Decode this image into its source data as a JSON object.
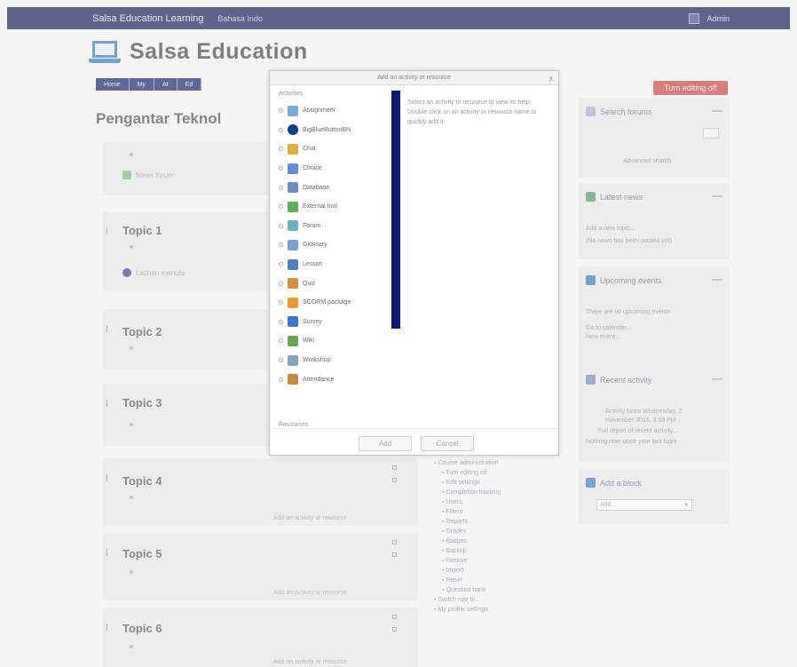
{
  "navbar": {
    "brand": "Salsa Education Learning",
    "language": "Bahasa Indo",
    "user_name": "Admin"
  },
  "header": {
    "site_title": "Salsa Education"
  },
  "nav_buttons": [
    "Home",
    "My",
    "At",
    "Ed"
  ],
  "course": {
    "title": "Pengantar Teknol"
  },
  "sections": [
    {
      "title": "",
      "activity": "News forum"
    },
    {
      "title": "Topic 1",
      "activity": "Latihan menulis"
    },
    {
      "title": "Topic 2"
    },
    {
      "title": "Topic 3"
    },
    {
      "title": "Topic 4",
      "hint": "Add an activity or resource"
    },
    {
      "title": "Topic 5",
      "hint": "Add an activity or resource"
    },
    {
      "title": "Topic 6",
      "hint": "Add an activity or resource"
    }
  ],
  "right_blocks": {
    "edit_button": "Turn editing off",
    "search_forums": {
      "title": "Search forums",
      "note": "Advanced search"
    },
    "latest_news": {
      "title": "Latest news",
      "line1": "Add a new topic...",
      "line2": "(No news has been posted yet)"
    },
    "upcoming_events": {
      "title": "Upcoming events",
      "line1": "There are no upcoming events",
      "line2": "Go to calendar...",
      "line3": "New event..."
    },
    "recent_activity": {
      "title": "Recent activity",
      "line1": "Activity since Wednesday, 2",
      "line2": "November 2016, 3:58 PM",
      "line3": "Full report of recent activity...",
      "line4": "Nothing new since your last login"
    },
    "add_block": {
      "title": "Add a block",
      "select_value": "Add..."
    }
  },
  "admin_tree": [
    {
      "label": "Course administration",
      "level": 1
    },
    {
      "label": "Turn editing off",
      "level": 2
    },
    {
      "label": "Edit settings",
      "level": 2
    },
    {
      "label": "Completion tracking",
      "level": 2
    },
    {
      "label": "Users",
      "level": 2
    },
    {
      "label": "Filters",
      "level": 2
    },
    {
      "label": "Reports",
      "level": 2
    },
    {
      "label": "Grades",
      "level": 2
    },
    {
      "label": "Badges",
      "level": 2
    },
    {
      "label": "Backup",
      "level": 2
    },
    {
      "label": "Restore",
      "level": 2
    },
    {
      "label": "Import",
      "level": 2
    },
    {
      "label": "Reset",
      "level": 2
    },
    {
      "label": "Question bank",
      "level": 2
    },
    {
      "label": "Switch role to...",
      "level": 1
    },
    {
      "label": "My profile settings",
      "level": 1
    }
  ],
  "modal": {
    "title": "Add an activity or resource",
    "close_label": "x",
    "options_heading": "Activities",
    "options": [
      {
        "label": "Assignment",
        "color": "#7fa8d6"
      },
      {
        "label": "BigBlueButtonBN",
        "color": "#1a3c8c"
      },
      {
        "label": "Chat",
        "color": "#e0b23a"
      },
      {
        "label": "Choice",
        "color": "#5a8fd6"
      },
      {
        "label": "Database",
        "color": "#6a8ec4"
      },
      {
        "label": "External tool",
        "color": "#5bb05b"
      },
      {
        "label": "Forum",
        "color": "#6bb2c2"
      },
      {
        "label": "Glossary",
        "color": "#7da2c8"
      },
      {
        "label": "Lesson",
        "color": "#4f7fc4"
      },
      {
        "label": "Quiz",
        "color": "#d98f3a"
      },
      {
        "label": "SCORM package",
        "color": "#e69d2e"
      },
      {
        "label": "Survey",
        "color": "#3a78c8"
      },
      {
        "label": "Wiki",
        "color": "#6aa84f"
      },
      {
        "label": "Workshop",
        "color": "#8aa0c0"
      },
      {
        "label": "Attendance",
        "color": "#c58a3a"
      }
    ],
    "resources_heading": "Resources",
    "description": "Select an activity or resource to view its help. Double-click on an activity or resource name to quickly add it.",
    "add_button": "Add",
    "cancel_button": "Cancel"
  }
}
